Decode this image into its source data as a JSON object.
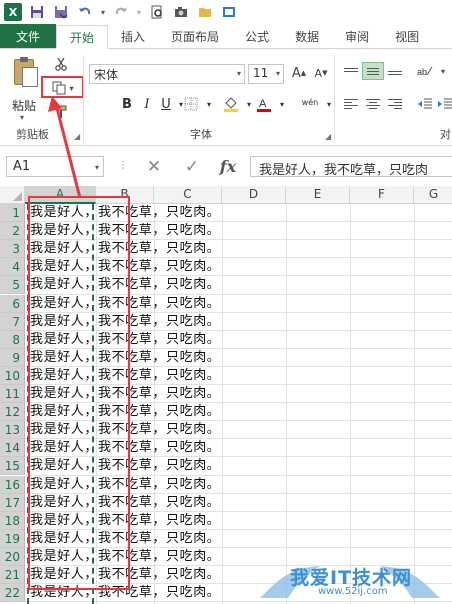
{
  "qat": {
    "app_icon": "X",
    "icons": [
      "excel-logo",
      "save-icon",
      "save-as-icon",
      "undo-icon",
      "redo-icon",
      "print-preview-icon",
      "camera-icon",
      "folder-icon",
      "publish-icon"
    ]
  },
  "ribbon_tabs": [
    "文件",
    "开始",
    "插入",
    "页面布局",
    "公式",
    "数据",
    "审阅",
    "视图"
  ],
  "ribbon": {
    "paste_label": "粘贴",
    "clipboard_group": "剪贴板",
    "font_group": "字体",
    "alignment_group_partial": "对",
    "font_name": "宋体",
    "font_size": "11",
    "bold": "B",
    "italic": "I",
    "underline": "U",
    "wen": "wén",
    "grow_font": "A",
    "shrink_font": "A"
  },
  "formula_bar": {
    "name_box": "A1",
    "cancel_symbol": "✕",
    "enter_symbol": "✓",
    "fx": "fx",
    "formula": "我是好人，我不吃草，只吃肉"
  },
  "columns": [
    "A",
    "B",
    "C",
    "D",
    "E",
    "F",
    "G"
  ],
  "rows": [
    "1",
    "2",
    "3",
    "4",
    "5",
    "6",
    "7",
    "8",
    "9",
    "10",
    "11",
    "12",
    "13",
    "14",
    "15",
    "16",
    "17",
    "18",
    "19",
    "20",
    "21",
    "22"
  ],
  "cell_text": "我是好人，我不吃草，只吃肉。",
  "watermark": {
    "text": "我爱IT技术网",
    "url": "www.52ij.com"
  },
  "colors": {
    "excel_green": "#217346",
    "highlight_red": "#e8383d",
    "selected_header": "#d3d3d3"
  }
}
